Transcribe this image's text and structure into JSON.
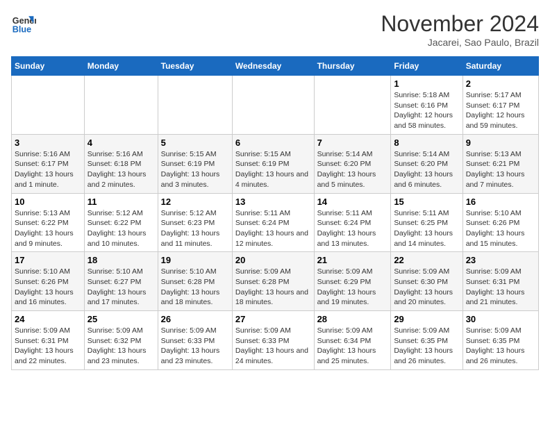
{
  "logo": {
    "line1": "General",
    "line2": "Blue"
  },
  "title": "November 2024",
  "subtitle": "Jacarei, Sao Paulo, Brazil",
  "days_of_week": [
    "Sunday",
    "Monday",
    "Tuesday",
    "Wednesday",
    "Thursday",
    "Friday",
    "Saturday"
  ],
  "weeks": [
    [
      {
        "num": "",
        "info": ""
      },
      {
        "num": "",
        "info": ""
      },
      {
        "num": "",
        "info": ""
      },
      {
        "num": "",
        "info": ""
      },
      {
        "num": "",
        "info": ""
      },
      {
        "num": "1",
        "info": "Sunrise: 5:18 AM\nSunset: 6:16 PM\nDaylight: 12 hours and 58 minutes."
      },
      {
        "num": "2",
        "info": "Sunrise: 5:17 AM\nSunset: 6:17 PM\nDaylight: 12 hours and 59 minutes."
      }
    ],
    [
      {
        "num": "3",
        "info": "Sunrise: 5:16 AM\nSunset: 6:17 PM\nDaylight: 13 hours and 1 minute."
      },
      {
        "num": "4",
        "info": "Sunrise: 5:16 AM\nSunset: 6:18 PM\nDaylight: 13 hours and 2 minutes."
      },
      {
        "num": "5",
        "info": "Sunrise: 5:15 AM\nSunset: 6:19 PM\nDaylight: 13 hours and 3 minutes."
      },
      {
        "num": "6",
        "info": "Sunrise: 5:15 AM\nSunset: 6:19 PM\nDaylight: 13 hours and 4 minutes."
      },
      {
        "num": "7",
        "info": "Sunrise: 5:14 AM\nSunset: 6:20 PM\nDaylight: 13 hours and 5 minutes."
      },
      {
        "num": "8",
        "info": "Sunrise: 5:14 AM\nSunset: 6:20 PM\nDaylight: 13 hours and 6 minutes."
      },
      {
        "num": "9",
        "info": "Sunrise: 5:13 AM\nSunset: 6:21 PM\nDaylight: 13 hours and 7 minutes."
      }
    ],
    [
      {
        "num": "10",
        "info": "Sunrise: 5:13 AM\nSunset: 6:22 PM\nDaylight: 13 hours and 9 minutes."
      },
      {
        "num": "11",
        "info": "Sunrise: 5:12 AM\nSunset: 6:22 PM\nDaylight: 13 hours and 10 minutes."
      },
      {
        "num": "12",
        "info": "Sunrise: 5:12 AM\nSunset: 6:23 PM\nDaylight: 13 hours and 11 minutes."
      },
      {
        "num": "13",
        "info": "Sunrise: 5:11 AM\nSunset: 6:24 PM\nDaylight: 13 hours and 12 minutes."
      },
      {
        "num": "14",
        "info": "Sunrise: 5:11 AM\nSunset: 6:24 PM\nDaylight: 13 hours and 13 minutes."
      },
      {
        "num": "15",
        "info": "Sunrise: 5:11 AM\nSunset: 6:25 PM\nDaylight: 13 hours and 14 minutes."
      },
      {
        "num": "16",
        "info": "Sunrise: 5:10 AM\nSunset: 6:26 PM\nDaylight: 13 hours and 15 minutes."
      }
    ],
    [
      {
        "num": "17",
        "info": "Sunrise: 5:10 AM\nSunset: 6:26 PM\nDaylight: 13 hours and 16 minutes."
      },
      {
        "num": "18",
        "info": "Sunrise: 5:10 AM\nSunset: 6:27 PM\nDaylight: 13 hours and 17 minutes."
      },
      {
        "num": "19",
        "info": "Sunrise: 5:10 AM\nSunset: 6:28 PM\nDaylight: 13 hours and 18 minutes."
      },
      {
        "num": "20",
        "info": "Sunrise: 5:09 AM\nSunset: 6:28 PM\nDaylight: 13 hours and 18 minutes."
      },
      {
        "num": "21",
        "info": "Sunrise: 5:09 AM\nSunset: 6:29 PM\nDaylight: 13 hours and 19 minutes."
      },
      {
        "num": "22",
        "info": "Sunrise: 5:09 AM\nSunset: 6:30 PM\nDaylight: 13 hours and 20 minutes."
      },
      {
        "num": "23",
        "info": "Sunrise: 5:09 AM\nSunset: 6:31 PM\nDaylight: 13 hours and 21 minutes."
      }
    ],
    [
      {
        "num": "24",
        "info": "Sunrise: 5:09 AM\nSunset: 6:31 PM\nDaylight: 13 hours and 22 minutes."
      },
      {
        "num": "25",
        "info": "Sunrise: 5:09 AM\nSunset: 6:32 PM\nDaylight: 13 hours and 23 minutes."
      },
      {
        "num": "26",
        "info": "Sunrise: 5:09 AM\nSunset: 6:33 PM\nDaylight: 13 hours and 23 minutes."
      },
      {
        "num": "27",
        "info": "Sunrise: 5:09 AM\nSunset: 6:33 PM\nDaylight: 13 hours and 24 minutes."
      },
      {
        "num": "28",
        "info": "Sunrise: 5:09 AM\nSunset: 6:34 PM\nDaylight: 13 hours and 25 minutes."
      },
      {
        "num": "29",
        "info": "Sunrise: 5:09 AM\nSunset: 6:35 PM\nDaylight: 13 hours and 26 minutes."
      },
      {
        "num": "30",
        "info": "Sunrise: 5:09 AM\nSunset: 6:35 PM\nDaylight: 13 hours and 26 minutes."
      }
    ]
  ]
}
